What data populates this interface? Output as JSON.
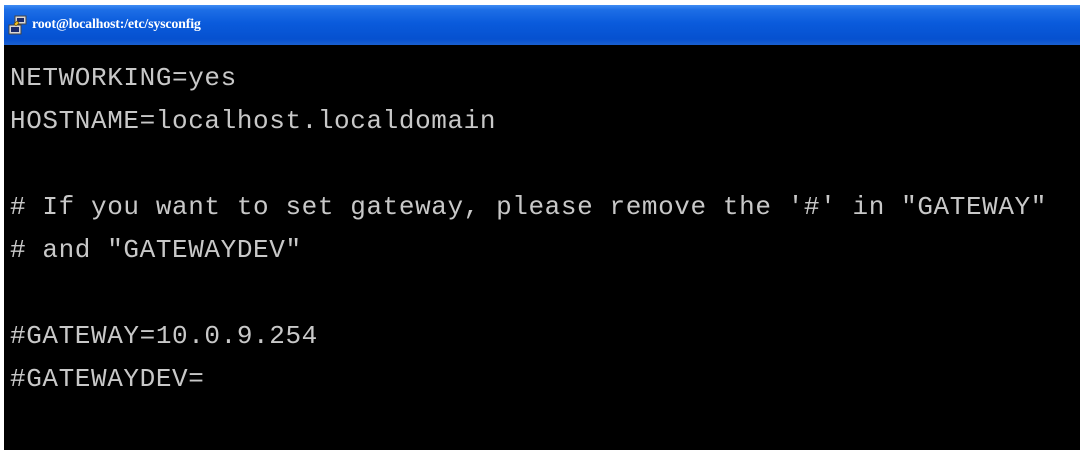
{
  "window": {
    "title": "root@localhost:/etc/sysconfig",
    "icon": "putty-terminal-icon"
  },
  "terminal": {
    "lines": [
      "NETWORKING=yes",
      "HOSTNAME=localhost.localdomain",
      "",
      "# If you want to set gateway, please remove the '#' in \"GATEWAY\"",
      "# and \"GATEWAYDEV\"",
      "",
      "#GATEWAY=10.0.9.254",
      "#GATEWAYDEV="
    ]
  },
  "colors": {
    "titlebar": "#0a5bdc",
    "terminal_bg": "#000000",
    "terminal_fg": "#c8c8c8"
  }
}
